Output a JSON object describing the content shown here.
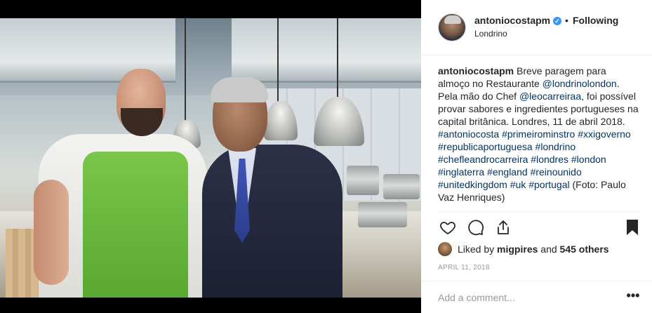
{
  "post": {
    "author": {
      "username": "antoniocostapm",
      "verified": true,
      "follow_status": "Following",
      "location": "Londrino"
    },
    "caption": {
      "segments": [
        {
          "text": "Breve paragem para almoço no Restaurante ",
          "type": "text"
        },
        {
          "text": "@londrinolondon",
          "type": "mention"
        },
        {
          "text": ". Pela mão do Chef ",
          "type": "text"
        },
        {
          "text": "@leocarreiraa",
          "type": "mention"
        },
        {
          "text": ", foi possível provar sabores e ingredientes portugueses na capital britânica. Londres, 11 de abril 2018. ",
          "type": "text"
        },
        {
          "text": "#antoniocosta",
          "type": "hashtag"
        },
        {
          "text": " ",
          "type": "text"
        },
        {
          "text": "#primeirominstro",
          "type": "hashtag"
        },
        {
          "text": " ",
          "type": "text"
        },
        {
          "text": "#xxigoverno",
          "type": "hashtag"
        },
        {
          "text": " ",
          "type": "text"
        },
        {
          "text": "#republicaportuguesa",
          "type": "hashtag"
        },
        {
          "text": " ",
          "type": "text"
        },
        {
          "text": "#londrino",
          "type": "hashtag"
        },
        {
          "text": " ",
          "type": "text"
        },
        {
          "text": "#chefleandrocarreira",
          "type": "hashtag"
        },
        {
          "text": " ",
          "type": "text"
        },
        {
          "text": "#londres",
          "type": "hashtag"
        },
        {
          "text": " ",
          "type": "text"
        },
        {
          "text": "#london",
          "type": "hashtag"
        },
        {
          "text": " ",
          "type": "text"
        },
        {
          "text": "#inglaterra",
          "type": "hashtag"
        },
        {
          "text": " ",
          "type": "text"
        },
        {
          "text": "#england",
          "type": "hashtag"
        },
        {
          "text": " ",
          "type": "text"
        },
        {
          "text": "#reinounido",
          "type": "hashtag"
        },
        {
          "text": " ",
          "type": "text"
        },
        {
          "text": "#unitedkingdom",
          "type": "hashtag"
        },
        {
          "text": " ",
          "type": "text"
        },
        {
          "text": "#uk",
          "type": "hashtag"
        },
        {
          "text": " ",
          "type": "text"
        },
        {
          "text": "#portugal",
          "type": "hashtag"
        },
        {
          "text": " (Foto: Paulo Vaz Henriques)",
          "type": "text"
        }
      ]
    },
    "likes": {
      "prefix": "Liked by ",
      "first_liker": "migpires",
      "joiner": " and ",
      "others": "545 others"
    },
    "date": "APRIL 11, 2018",
    "comment_placeholder": "Add a comment...",
    "more_label": "•••"
  },
  "icons": {
    "like": "heart-icon",
    "comment": "comment-bubble-icon",
    "share": "share-icon",
    "save": "bookmark-icon",
    "verified": "verified-badge-icon",
    "more": "more-options-icon"
  },
  "colors": {
    "verified": "#3897f0",
    "link": "#003569",
    "muted": "#999999",
    "text": "#262626"
  }
}
